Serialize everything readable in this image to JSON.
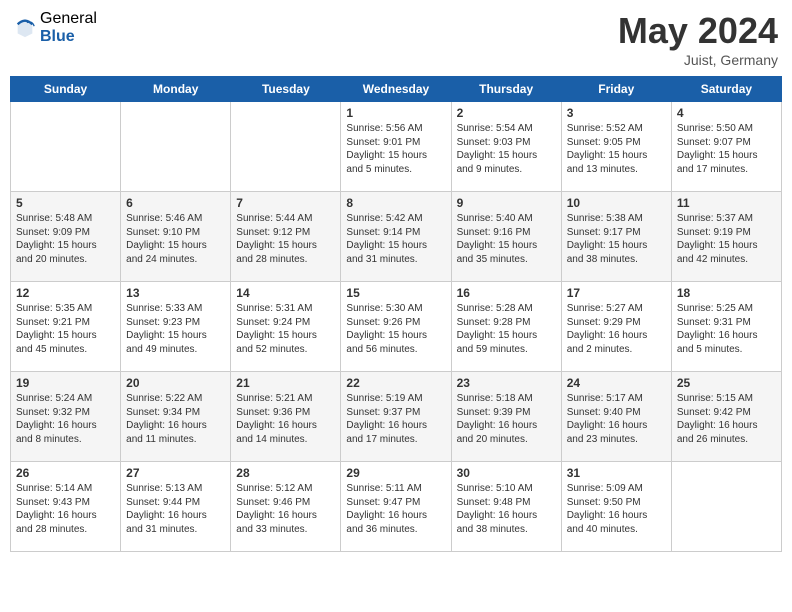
{
  "header": {
    "logo_general": "General",
    "logo_blue": "Blue",
    "title": "May 2024",
    "location": "Juist, Germany"
  },
  "days_of_week": [
    "Sunday",
    "Monday",
    "Tuesday",
    "Wednesday",
    "Thursday",
    "Friday",
    "Saturday"
  ],
  "weeks": [
    [
      {
        "day": "",
        "info": ""
      },
      {
        "day": "",
        "info": ""
      },
      {
        "day": "",
        "info": ""
      },
      {
        "day": "1",
        "info": "Sunrise: 5:56 AM\nSunset: 9:01 PM\nDaylight: 15 hours\nand 5 minutes."
      },
      {
        "day": "2",
        "info": "Sunrise: 5:54 AM\nSunset: 9:03 PM\nDaylight: 15 hours\nand 9 minutes."
      },
      {
        "day": "3",
        "info": "Sunrise: 5:52 AM\nSunset: 9:05 PM\nDaylight: 15 hours\nand 13 minutes."
      },
      {
        "day": "4",
        "info": "Sunrise: 5:50 AM\nSunset: 9:07 PM\nDaylight: 15 hours\nand 17 minutes."
      }
    ],
    [
      {
        "day": "5",
        "info": "Sunrise: 5:48 AM\nSunset: 9:09 PM\nDaylight: 15 hours\nand 20 minutes."
      },
      {
        "day": "6",
        "info": "Sunrise: 5:46 AM\nSunset: 9:10 PM\nDaylight: 15 hours\nand 24 minutes."
      },
      {
        "day": "7",
        "info": "Sunrise: 5:44 AM\nSunset: 9:12 PM\nDaylight: 15 hours\nand 28 minutes."
      },
      {
        "day": "8",
        "info": "Sunrise: 5:42 AM\nSunset: 9:14 PM\nDaylight: 15 hours\nand 31 minutes."
      },
      {
        "day": "9",
        "info": "Sunrise: 5:40 AM\nSunset: 9:16 PM\nDaylight: 15 hours\nand 35 minutes."
      },
      {
        "day": "10",
        "info": "Sunrise: 5:38 AM\nSunset: 9:17 PM\nDaylight: 15 hours\nand 38 minutes."
      },
      {
        "day": "11",
        "info": "Sunrise: 5:37 AM\nSunset: 9:19 PM\nDaylight: 15 hours\nand 42 minutes."
      }
    ],
    [
      {
        "day": "12",
        "info": "Sunrise: 5:35 AM\nSunset: 9:21 PM\nDaylight: 15 hours\nand 45 minutes."
      },
      {
        "day": "13",
        "info": "Sunrise: 5:33 AM\nSunset: 9:23 PM\nDaylight: 15 hours\nand 49 minutes."
      },
      {
        "day": "14",
        "info": "Sunrise: 5:31 AM\nSunset: 9:24 PM\nDaylight: 15 hours\nand 52 minutes."
      },
      {
        "day": "15",
        "info": "Sunrise: 5:30 AM\nSunset: 9:26 PM\nDaylight: 15 hours\nand 56 minutes."
      },
      {
        "day": "16",
        "info": "Sunrise: 5:28 AM\nSunset: 9:28 PM\nDaylight: 15 hours\nand 59 minutes."
      },
      {
        "day": "17",
        "info": "Sunrise: 5:27 AM\nSunset: 9:29 PM\nDaylight: 16 hours\nand 2 minutes."
      },
      {
        "day": "18",
        "info": "Sunrise: 5:25 AM\nSunset: 9:31 PM\nDaylight: 16 hours\nand 5 minutes."
      }
    ],
    [
      {
        "day": "19",
        "info": "Sunrise: 5:24 AM\nSunset: 9:32 PM\nDaylight: 16 hours\nand 8 minutes."
      },
      {
        "day": "20",
        "info": "Sunrise: 5:22 AM\nSunset: 9:34 PM\nDaylight: 16 hours\nand 11 minutes."
      },
      {
        "day": "21",
        "info": "Sunrise: 5:21 AM\nSunset: 9:36 PM\nDaylight: 16 hours\nand 14 minutes."
      },
      {
        "day": "22",
        "info": "Sunrise: 5:19 AM\nSunset: 9:37 PM\nDaylight: 16 hours\nand 17 minutes."
      },
      {
        "day": "23",
        "info": "Sunrise: 5:18 AM\nSunset: 9:39 PM\nDaylight: 16 hours\nand 20 minutes."
      },
      {
        "day": "24",
        "info": "Sunrise: 5:17 AM\nSunset: 9:40 PM\nDaylight: 16 hours\nand 23 minutes."
      },
      {
        "day": "25",
        "info": "Sunrise: 5:15 AM\nSunset: 9:42 PM\nDaylight: 16 hours\nand 26 minutes."
      }
    ],
    [
      {
        "day": "26",
        "info": "Sunrise: 5:14 AM\nSunset: 9:43 PM\nDaylight: 16 hours\nand 28 minutes."
      },
      {
        "day": "27",
        "info": "Sunrise: 5:13 AM\nSunset: 9:44 PM\nDaylight: 16 hours\nand 31 minutes."
      },
      {
        "day": "28",
        "info": "Sunrise: 5:12 AM\nSunset: 9:46 PM\nDaylight: 16 hours\nand 33 minutes."
      },
      {
        "day": "29",
        "info": "Sunrise: 5:11 AM\nSunset: 9:47 PM\nDaylight: 16 hours\nand 36 minutes."
      },
      {
        "day": "30",
        "info": "Sunrise: 5:10 AM\nSunset: 9:48 PM\nDaylight: 16 hours\nand 38 minutes."
      },
      {
        "day": "31",
        "info": "Sunrise: 5:09 AM\nSunset: 9:50 PM\nDaylight: 16 hours\nand 40 minutes."
      },
      {
        "day": "",
        "info": ""
      }
    ]
  ]
}
